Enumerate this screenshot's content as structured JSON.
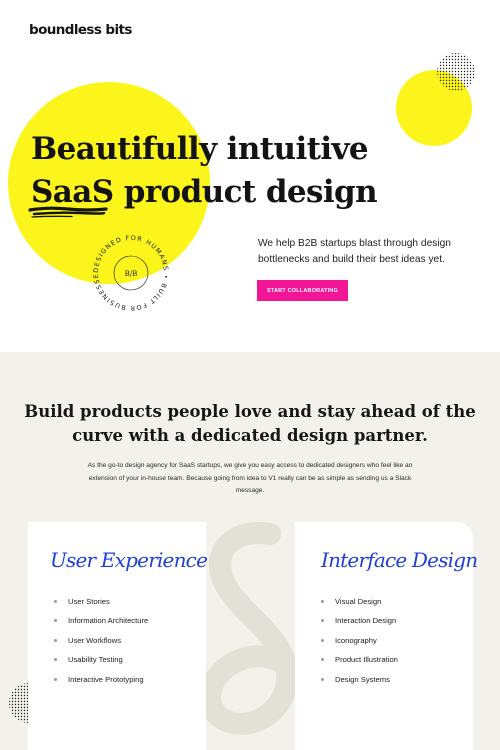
{
  "brand": {
    "logo_text": "boundless bits"
  },
  "hero": {
    "title_line1": "Beautifully intuitive",
    "title_line2": "SaaS product design",
    "subtitle_line1": "We help B2B startups blast through design",
    "subtitle_line2": "bottlenecks and build their best ideas yet.",
    "cta_label": "START COLLABORATING",
    "badge_text": "DESIGNED FOR HUMANS • BUILT FOR BUSINESSES •",
    "badge_monogram": "B/B"
  },
  "services": {
    "title_line1": "Build products people love and stay ahead of the",
    "title_line2": "curve with a dedicated design partner.",
    "description_line1": "As the go-to design agency for SaaS startups, we give you easy access to dedicated designers who feel like an",
    "description_line2": "extension of your in-house team. Because going from idea to V1 really can be as simple as sending us a Slack",
    "description_line3": "message.",
    "cards": [
      {
        "title": "User Experience",
        "items": [
          "User Stories",
          "Information Architecture",
          "User Workflows",
          "Usability Testing",
          "Interactive Prototyping"
        ]
      },
      {
        "title": "Interface Design",
        "items": [
          "Visual Design",
          "Interaction Design",
          "Iconography",
          "Product Illustration",
          "Design Systems"
        ]
      }
    ]
  },
  "colors": {
    "accent_yellow": "#fbf51b",
    "cta_pink": "#f21596",
    "script_blue": "#1f3fd8",
    "section_bg": "#f3f1ec"
  }
}
